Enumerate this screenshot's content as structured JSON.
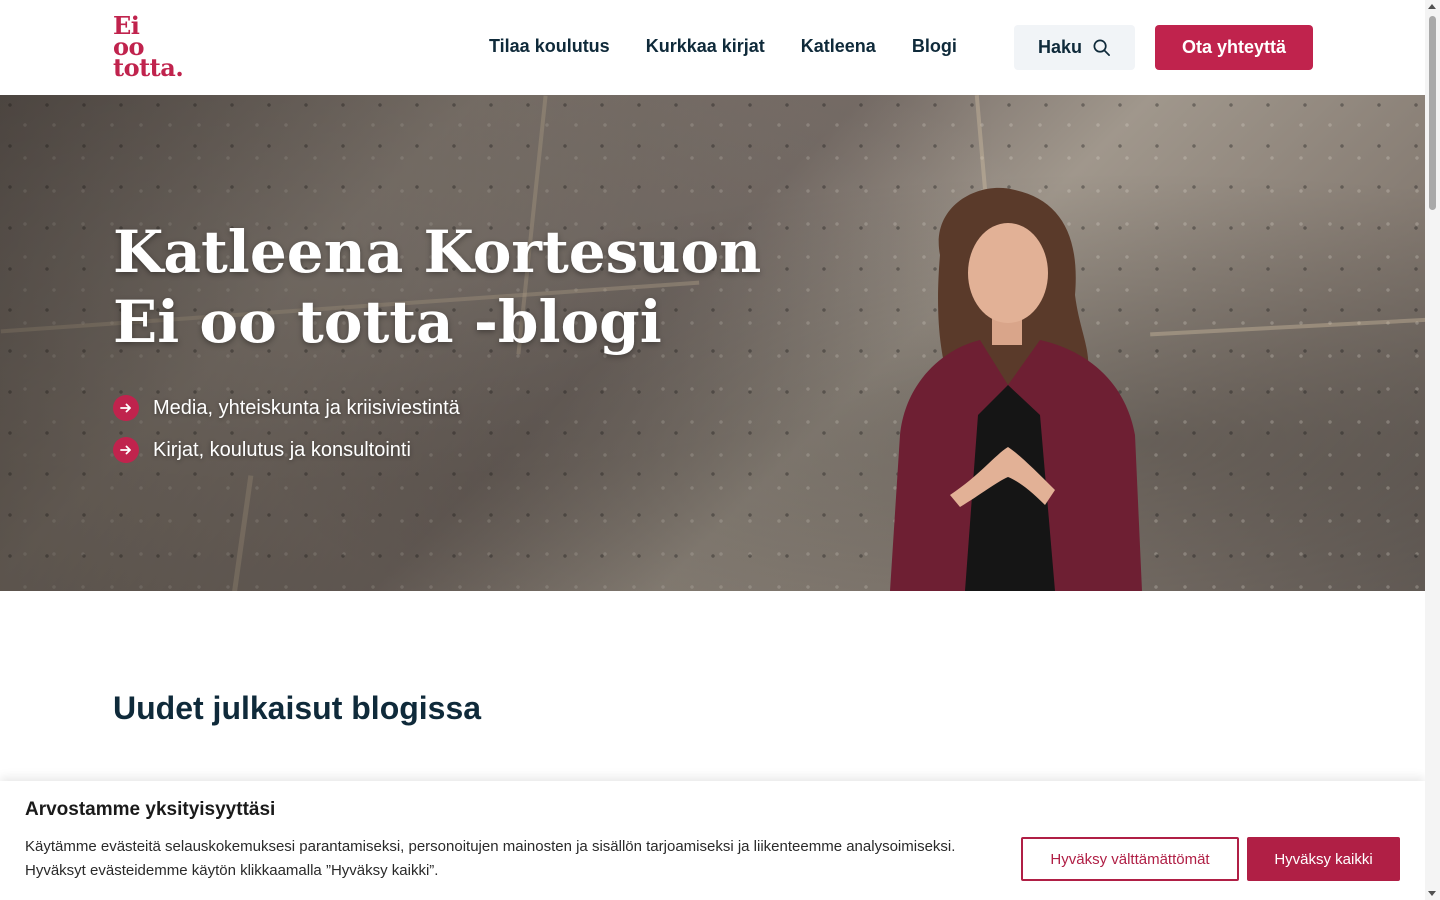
{
  "logo": {
    "line1": "Ei",
    "line2": "oo",
    "line3": "totta."
  },
  "nav": {
    "items": [
      {
        "label": "Tilaa koulutus"
      },
      {
        "label": "Kurkkaa kirjat"
      },
      {
        "label": "Katleena"
      },
      {
        "label": "Blogi"
      }
    ],
    "search_label": "Haku",
    "contact_label": "Ota yhteyttä"
  },
  "hero": {
    "title_line1": "Katleena Kortesuon",
    "title_line2": "Ei oo totta -blogi",
    "bullets": [
      "Media, yhteiskunta ja kriisiviestintä",
      "Kirjat, koulutus ja konsultointi"
    ]
  },
  "section": {
    "title": "Uudet julkaisut blogissa"
  },
  "cookie": {
    "title": "Arvostamme yksityisyyttäsi",
    "text": "Käytämme evästeitä selauskokemuksesi parantamiseksi, personoitujen mainosten ja sisällön tarjoamiseksi ja liikenteemme analysoimiseksi. Hyväksyt evästeidemme käytön klikkaamalla ”Hyväksy kaikki”.",
    "necessary_label": "Hyväksy välttämättömät",
    "accept_all_label": "Hyväksy kaikki"
  },
  "colors": {
    "brand": "#c0234d",
    "text": "#0f2a3a",
    "search_bg": "#f1f4f7"
  },
  "icons": {
    "search": "search-icon",
    "bullet": "arrow-right-icon"
  }
}
